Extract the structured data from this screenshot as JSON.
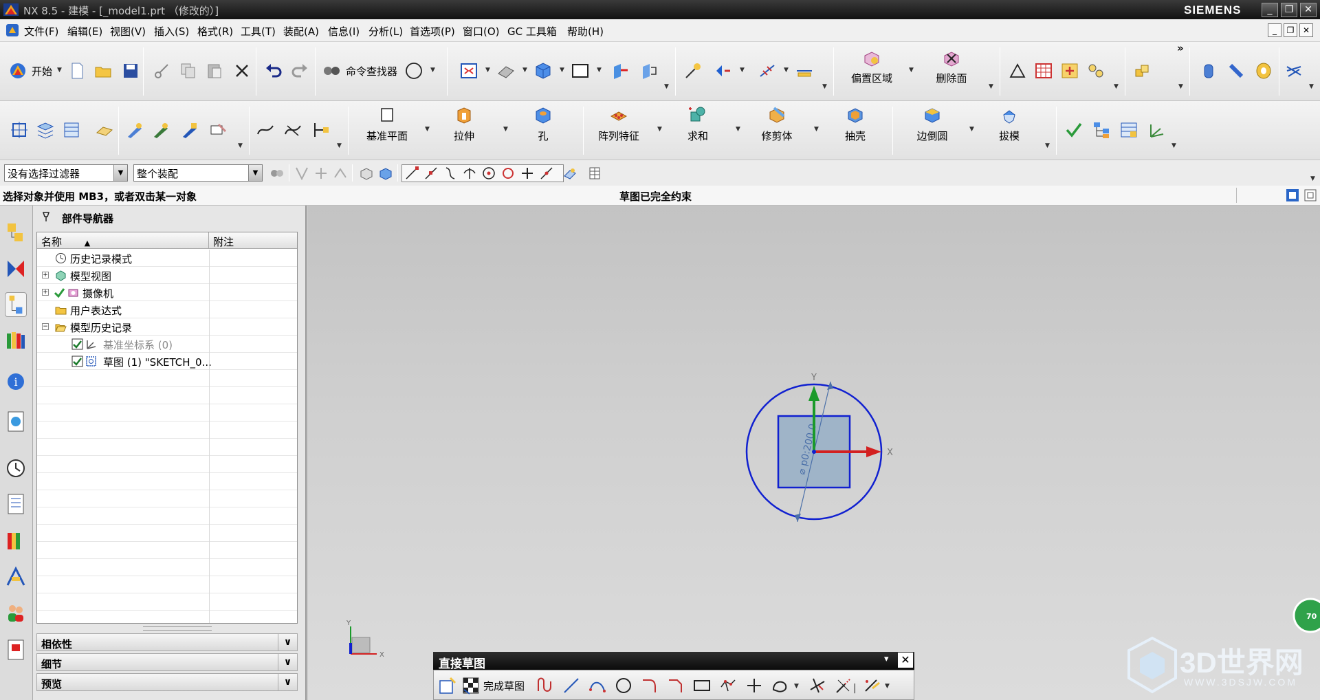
{
  "window": {
    "title": "NX 8.5 - 建模 - [_model1.prt （修改的）]",
    "brand": "SIEMENS",
    "controls": [
      "_",
      "❐",
      "✕"
    ]
  },
  "menubar": {
    "items": [
      "文件(F)",
      "编辑(E)",
      "视图(V)",
      "插入(S)",
      "格式(R)",
      "工具(T)",
      "装配(A)",
      "信息(I)",
      "分析(L)",
      "首选项(P)",
      "窗口(O)",
      "GC 工具箱",
      "帮助(H)"
    ]
  },
  "toolbar1": {
    "start_label": "开始",
    "command_finder_label": "命令查找器",
    "offset_region_label": "偏置区域",
    "delete_face_label": "删除面",
    "overflow_glyph": "»"
  },
  "toolbar2": {
    "datum_plane_label": "基准平面",
    "extrude_label": "拉伸",
    "hole_label": "孔",
    "pattern_feature_label": "阵列特征",
    "unite_label": "求和",
    "trim_body_label": "修剪体",
    "shell_label": "抽壳",
    "edge_blend_label": "边倒圆",
    "draft_label": "拔模"
  },
  "selectionbar": {
    "filter_value": "没有选择过滤器",
    "scope_value": "整个装配"
  },
  "status": {
    "prompt": "选择对象并使用 MB3，或者双击某一对象",
    "message": "草图已完全约束"
  },
  "navigator": {
    "title": "部件导航器",
    "columns": [
      "名称",
      "附注"
    ],
    "sort_glyph": "▲",
    "rows": [
      {
        "label": "历史记录模式"
      },
      {
        "label": "模型视图"
      },
      {
        "label": "摄像机"
      },
      {
        "label": "用户表达式"
      },
      {
        "label": "模型历史记录"
      },
      {
        "label": "基准坐标系 (0)"
      },
      {
        "label": "草图 (1) \"SKETCH_0..."
      }
    ],
    "sections": [
      "相依性",
      "细节",
      "预览"
    ]
  },
  "viewport": {
    "dimension_label": "⌀ p0:200.0",
    "axis_x": "X",
    "axis_y": "Y",
    "triad_x": "X",
    "triad_y": "Y",
    "side_badge": "70",
    "sketch_color": "#1020d0",
    "square_fill": "#9fb4c8"
  },
  "sketch_toolbar": {
    "title": "直接草图",
    "finish_label": "完成草图",
    "menu_glyph": "▾",
    "close_glyph": "✕"
  },
  "watermark": {
    "main": "3D世界网",
    "sub": "WWW.3DSJW.COM"
  }
}
